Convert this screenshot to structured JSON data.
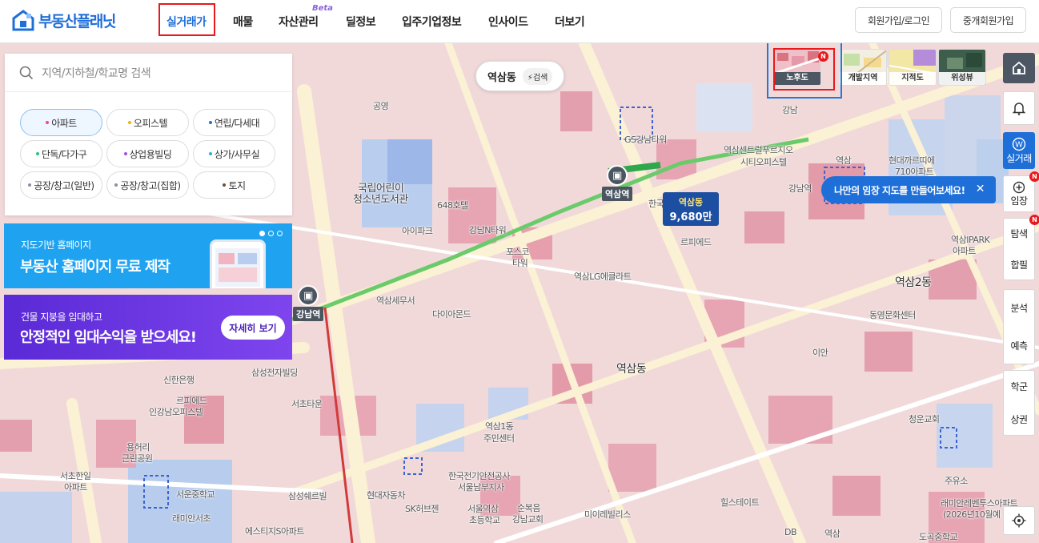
{
  "brand": {
    "logo_text": "부동산플래닛",
    "accent": "#1f6fd8"
  },
  "nav": {
    "items": [
      {
        "label": "실거래가",
        "active": true
      },
      {
        "label": "매물"
      },
      {
        "label": "자산관리",
        "badge": "Beta"
      },
      {
        "label": "딜정보"
      },
      {
        "label": "입주기업정보"
      },
      {
        "label": "인사이드"
      },
      {
        "label": "더보기"
      }
    ]
  },
  "header_buttons": {
    "login": "회원가입/로그인",
    "agent": "중개회원가입"
  },
  "search": {
    "placeholder": "지역/지하철/학교명 검색"
  },
  "filters": [
    {
      "label": "아파트",
      "color": "#f0449a",
      "active": true
    },
    {
      "label": "오피스텔",
      "color": "#f4b400"
    },
    {
      "label": "연립/다세대",
      "color": "#1f6fd8"
    },
    {
      "label": "단독/다가구",
      "color": "#2ec27e"
    },
    {
      "label": "상업용빌딩",
      "color": "#a64de6"
    },
    {
      "label": "상가/사무실",
      "color": "#22b5d8"
    },
    {
      "label": "공장/창고(일반)",
      "color": "#8a8fa3"
    },
    {
      "label": "공장/창고(집합)",
      "color": "#8a8fa3"
    },
    {
      "label": "토지",
      "color": "#7a4a2a"
    }
  ],
  "banners": {
    "homepage": {
      "subtitle": "지도기반 홈페이지",
      "title": "부동산 홈페이지 무료 제작"
    },
    "lease": {
      "subtitle": "건물 지붕을 임대하고",
      "title": "안정적인 임대수익을 받으세요!",
      "button": "자세히 보기"
    }
  },
  "region": {
    "name": "역삼동",
    "search_label": "검색"
  },
  "layers": [
    {
      "label": "노후도",
      "active": true,
      "new": true
    },
    {
      "label": "개발지역"
    },
    {
      "label": "지적도"
    },
    {
      "label": "위성뷰"
    }
  ],
  "right_toolbar": {
    "silgeorae": "실거래",
    "imjang": "임장",
    "tamsaek": "탐색",
    "habpil": "합필",
    "bunseok": "분석",
    "yecheuk": "예측",
    "hakgun": "학군",
    "sanggwon": "상권"
  },
  "tooltip": {
    "text": "나만의 임장 지도를 만들어보세요!",
    "close": "✕"
  },
  "stations": [
    {
      "name": "역삼역"
    },
    {
      "name": "강남역"
    }
  ],
  "price_marker": {
    "area": "역삼동",
    "value": "9,680만"
  },
  "map_labels": [
    "공영",
    "국립어린이",
    "청소년도서관",
    "648호텔",
    "아이파크",
    "역삼센트럴푸르지오",
    "시티오피스텔",
    "GS강남타워",
    "한국지식재산센터",
    "강남N타워",
    "포스코",
    "타워",
    "역삼LG에클라트",
    "역삼동",
    "역삼2동",
    "이안",
    "역삼1동",
    "주민센터",
    "서초타운",
    "인강남오피스텔",
    "삼성전자빌딩",
    "신한은행",
    "르피에드",
    "용허리",
    "근린공원",
    "서초한일",
    "아파트",
    "서운중학교",
    "래미안서초",
    "에스티지S아파트",
    "삼성쉐르빌",
    "현대자동차",
    "SK허브젠",
    "서울역삼",
    "초등학교",
    "한국전기안전공사",
    "서울남부지사",
    "순복음",
    "강남교회",
    "미이레빌리스",
    "현대까르띠에",
    "710아파트",
    "르피에드",
    "강남",
    "역삼",
    "힐스테이트",
    "DB",
    "역삼",
    "래미안레벤투스아파트",
    "(2026년10월예",
    "도곡중학교",
    "주유소",
    "청운교회",
    "역삼IPARK",
    "아파트",
    "동영문화센터",
    "강남역",
    "역삼세무서",
    "다이아몬드"
  ]
}
